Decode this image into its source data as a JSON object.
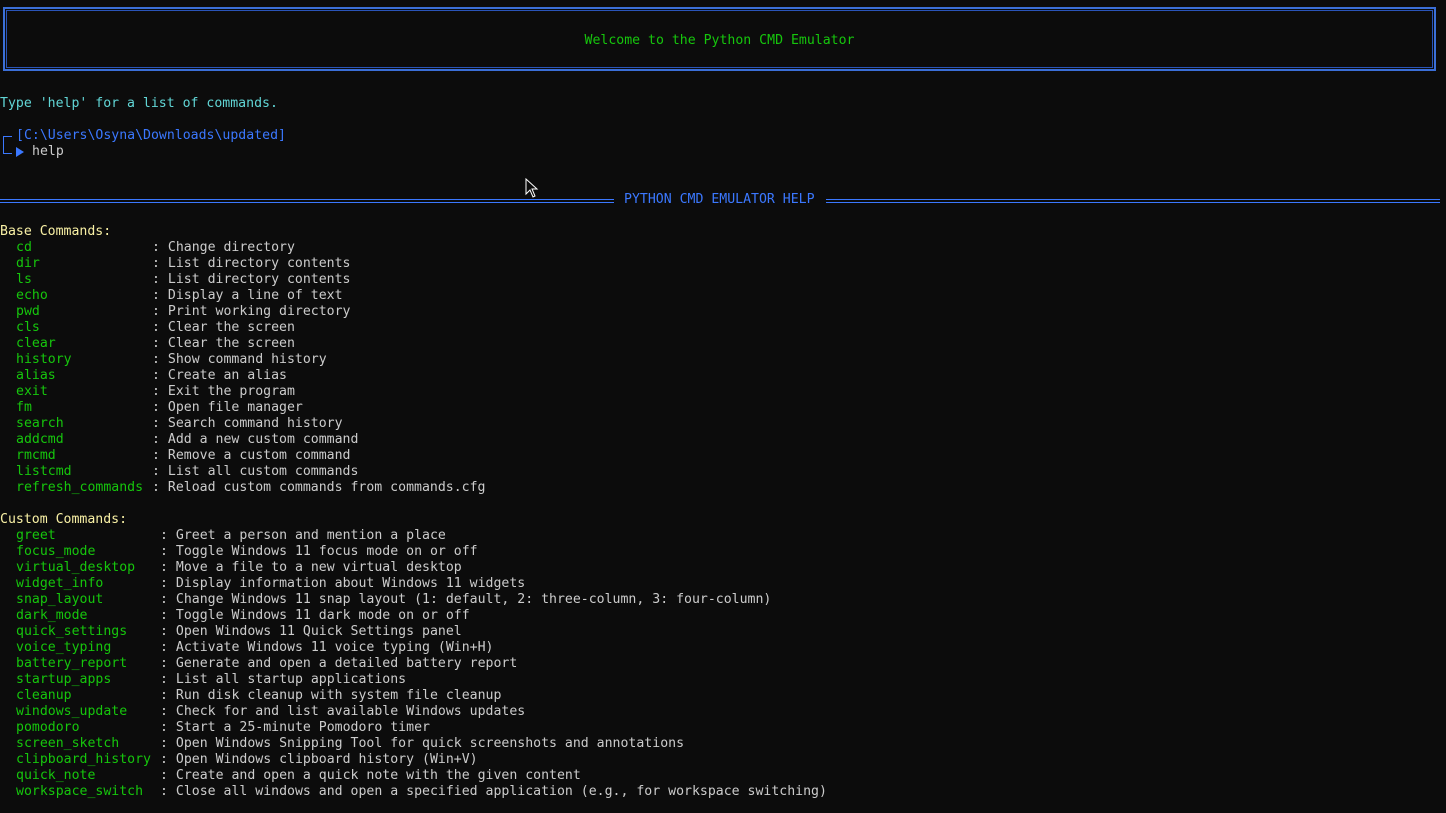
{
  "banner": {
    "title": "Welcome to the Python CMD Emulator"
  },
  "intro": "Type 'help' for a list of commands.",
  "prompt": {
    "path": "[C:\\Users\\Osyna\\Downloads\\updated]",
    "command": "help"
  },
  "help_header": "PYTHON CMD EMULATOR HELP",
  "base_section": {
    "title": "Base Commands:",
    "items": [
      {
        "cmd": "cd",
        "desc": ": Change directory"
      },
      {
        "cmd": "dir",
        "desc": ": List directory contents"
      },
      {
        "cmd": "ls",
        "desc": ": List directory contents"
      },
      {
        "cmd": "echo",
        "desc": ": Display a line of text"
      },
      {
        "cmd": "pwd",
        "desc": ": Print working directory"
      },
      {
        "cmd": "cls",
        "desc": ": Clear the screen"
      },
      {
        "cmd": "clear",
        "desc": ": Clear the screen"
      },
      {
        "cmd": "history",
        "desc": ": Show command history"
      },
      {
        "cmd": "alias",
        "desc": ": Create an alias"
      },
      {
        "cmd": "exit",
        "desc": ": Exit the program"
      },
      {
        "cmd": "fm",
        "desc": ": Open file manager"
      },
      {
        "cmd": "search",
        "desc": ": Search command history"
      },
      {
        "cmd": "addcmd",
        "desc": ": Add a new custom command"
      },
      {
        "cmd": "rmcmd",
        "desc": ": Remove a custom command"
      },
      {
        "cmd": "listcmd",
        "desc": ": List all custom commands"
      },
      {
        "cmd": "refresh_commands",
        "desc": ": Reload custom commands from commands.cfg"
      }
    ]
  },
  "custom_section": {
    "title": "Custom Commands:",
    "items": [
      {
        "cmd": "greet",
        "desc": ": Greet a person and mention a place"
      },
      {
        "cmd": "focus_mode",
        "desc": ": Toggle Windows 11 focus mode on or off"
      },
      {
        "cmd": "virtual_desktop",
        "desc": ": Move a file to a new virtual desktop"
      },
      {
        "cmd": "widget_info",
        "desc": ": Display information about Windows 11 widgets"
      },
      {
        "cmd": "snap_layout",
        "desc": ": Change Windows 11 snap layout (1: default, 2: three-column, 3: four-column)"
      },
      {
        "cmd": "dark_mode",
        "desc": ": Toggle Windows 11 dark mode on or off"
      },
      {
        "cmd": "quick_settings",
        "desc": ": Open Windows 11 Quick Settings panel"
      },
      {
        "cmd": "voice_typing",
        "desc": ": Activate Windows 11 voice typing (Win+H)"
      },
      {
        "cmd": "battery_report",
        "desc": ": Generate and open a detailed battery report"
      },
      {
        "cmd": "startup_apps",
        "desc": ": List all startup applications"
      },
      {
        "cmd": "cleanup",
        "desc": ": Run disk cleanup with system file cleanup"
      },
      {
        "cmd": "windows_update",
        "desc": ": Check for and list available Windows updates"
      },
      {
        "cmd": "pomodoro",
        "desc": ": Start a 25-minute Pomodoro timer"
      },
      {
        "cmd": "screen_sketch",
        "desc": ": Open Windows Snipping Tool for quick screenshots and annotations"
      },
      {
        "cmd": "clipboard_history",
        "desc": ": Open Windows clipboard history (Win+V)"
      },
      {
        "cmd": "quick_note",
        "desc": ": Create and open a quick note with the given content"
      },
      {
        "cmd": "workspace_switch",
        "desc": ": Close all windows and open a specified application (e.g., for workspace switching)"
      }
    ]
  },
  "colors": {
    "background": "#0c0c0c",
    "command": "#16c60c",
    "accent": "#3b78ff",
    "section": "#f9f1a5",
    "intro": "#61d6d6"
  },
  "icons": {
    "pointer": "mouse-pointer-icon",
    "prompt": "prompt-arrow-icon"
  }
}
